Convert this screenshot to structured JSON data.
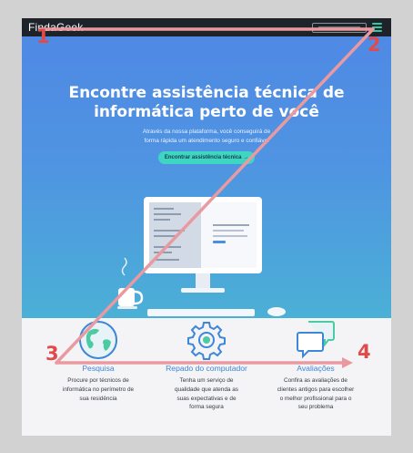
{
  "header": {
    "logo_main": "FindaGeek",
    "logo_suffix": "",
    "menu_icon": "hamburger-menu-icon",
    "accent_color": "#33c8a4"
  },
  "hero": {
    "title_line1": "Encontre assistência técnica de",
    "title_line2": "informática perto de você",
    "subtitle_line1": "Através da nossa plataforma, você conseguirá de",
    "subtitle_line2": "forma rápida um atendimento seguro e confiável",
    "cta_label": "Encontrar assistência técnica →",
    "gradient_top": "#4f89e4",
    "gradient_bottom": "#4bb0d6",
    "illustration_icon": "computer-desk-illustration"
  },
  "features": [
    {
      "icon": "globe-icon",
      "title": "Pesquisa",
      "desc_line1": "Procure por técnicos de",
      "desc_line2": "informática no perímetro de",
      "desc_line3": "sua residência",
      "desc_line4": ""
    },
    {
      "icon": "gear-icon",
      "title": "Repado do computador",
      "desc_line1": "Tenha um serviço de",
      "desc_line2": "qualidade que atenda as",
      "desc_line3": "suas expectativas e de",
      "desc_line4": "forma segura"
    },
    {
      "icon": "chat-bubbles-icon",
      "title": "Avaliações",
      "desc_line1": "Confira as avaliações de",
      "desc_line2": "clientes antigos para escolher",
      "desc_line3": "o melhor profissional para o",
      "desc_line4": "seu problema"
    }
  ],
  "annotations": {
    "color": "#e24a4a",
    "markers": [
      "1",
      "2",
      "3",
      "4"
    ]
  }
}
